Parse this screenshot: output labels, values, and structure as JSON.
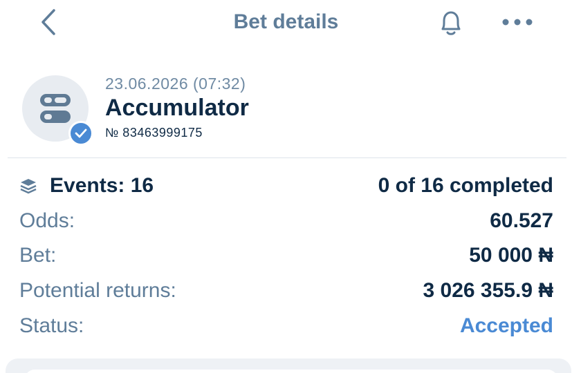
{
  "header": {
    "title": "Bet details"
  },
  "bet": {
    "date": "23.06.2026 (07:32)",
    "type": "Accumulator",
    "number": "№ 83463999175"
  },
  "details": {
    "events_label": "Events: 16",
    "events_value": "0 of 16 completed",
    "odds_label": "Odds:",
    "odds_value": "60.527",
    "bet_label": "Bet:",
    "bet_value": "50 000 ₦",
    "returns_label": "Potential returns:",
    "returns_value": "3 026 355.9 ₦",
    "status_label": "Status:",
    "status_value": "Accepted"
  },
  "colors": {
    "accent": "#4a8ad4",
    "label": "#5f7d99",
    "text": "#0f2a45"
  },
  "icons": {
    "back": "chevron-left-icon",
    "bell": "bell-icon",
    "more": "more-icon",
    "avatar": "accumulator-icon",
    "badge": "check-icon",
    "events": "layers-icon"
  }
}
